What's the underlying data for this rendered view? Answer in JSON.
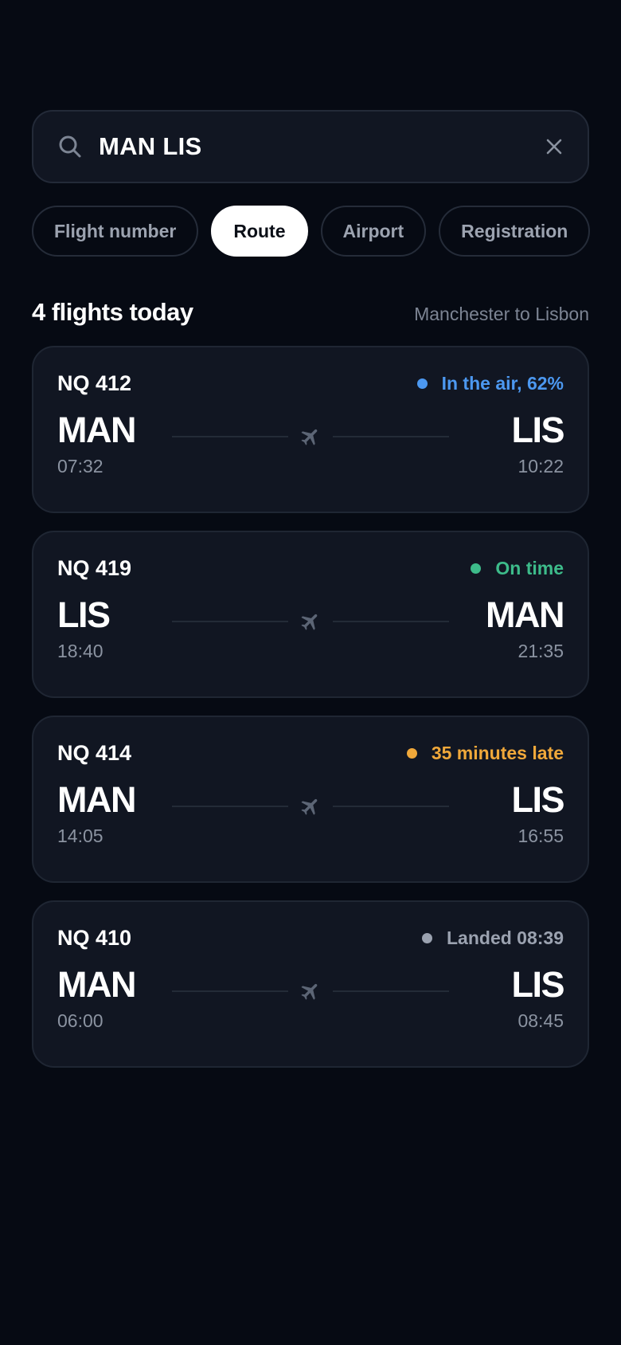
{
  "search": {
    "value": "MAN LIS",
    "icon": "search-icon",
    "clear_icon": "close-icon"
  },
  "chips": [
    {
      "label": "Flight number",
      "active": false
    },
    {
      "label": "Route",
      "active": true
    },
    {
      "label": "Airport",
      "active": false
    },
    {
      "label": "Registration",
      "active": false
    }
  ],
  "summary": {
    "count": "4 flights today",
    "route": "Manchester to Lisbon"
  },
  "colors": {
    "in_air": "#4c98f0",
    "on_time": "#3dbb8a",
    "late": "#f0a83a",
    "landed": "#9ba2b0"
  },
  "flights": [
    {
      "number": "NQ 412",
      "status": "In the air, 62%",
      "status_type": "in_air",
      "from": "MAN",
      "dep": "07:32",
      "to": "LIS",
      "arr": "10:22"
    },
    {
      "number": "NQ 419",
      "status": "On time",
      "status_type": "on_time",
      "from": "LIS",
      "dep": "18:40",
      "to": "MAN",
      "arr": "21:35"
    },
    {
      "number": "NQ 414",
      "status": "35 minutes late",
      "status_type": "late",
      "from": "MAN",
      "dep": "14:05",
      "to": "LIS",
      "arr": "16:55"
    },
    {
      "number": "NQ 410",
      "status": "Landed 08:39",
      "status_type": "landed",
      "from": "MAN",
      "dep": "06:00",
      "to": "LIS",
      "arr": "08:45"
    }
  ]
}
